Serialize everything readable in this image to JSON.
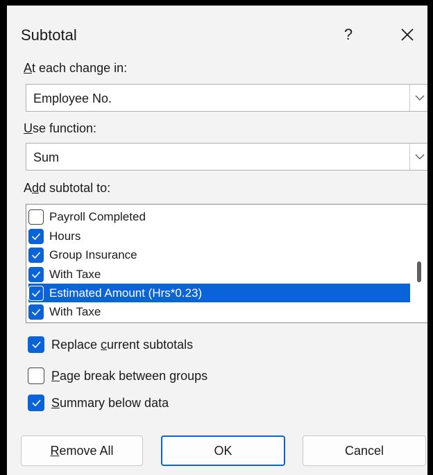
{
  "dialog": {
    "title": "Subtotal",
    "help_label": "?"
  },
  "change_field": {
    "label_prefix": "",
    "label_ul": "A",
    "label_rest": "t each change in:",
    "value": "Employee No."
  },
  "function_field": {
    "label_prefix": "",
    "label_ul": "U",
    "label_rest": "se function:",
    "value": "Sum"
  },
  "add_subtotal": {
    "label_prefix": "A",
    "label_ul": "d",
    "label_rest": "d subtotal to:",
    "items": [
      {
        "label": "Payroll Completed",
        "checked": false,
        "selected": false
      },
      {
        "label": "Hours",
        "checked": true,
        "selected": false
      },
      {
        "label": "Group Insurance",
        "checked": true,
        "selected": false
      },
      {
        "label": "With Taxe",
        "checked": true,
        "selected": false
      },
      {
        "label": "Estimated Amount (Hrs*0.23)",
        "checked": true,
        "selected": true
      },
      {
        "label": "With Taxe",
        "checked": true,
        "selected": false
      }
    ]
  },
  "options": {
    "replace": {
      "prefix": "Replace ",
      "ul": "c",
      "rest": "urrent subtotals",
      "checked": true
    },
    "page_break": {
      "prefix": "",
      "ul": "P",
      "rest": "age break between groups",
      "checked": false
    },
    "summary": {
      "prefix": "",
      "ul": "S",
      "rest": "ummary below data",
      "checked": true
    }
  },
  "buttons": {
    "remove_all": {
      "ul": "R",
      "rest": "emove All"
    },
    "ok": "OK",
    "cancel": "Cancel"
  },
  "colors": {
    "accent": "#0a64d8",
    "dialog_bg": "#f3f3f3"
  }
}
